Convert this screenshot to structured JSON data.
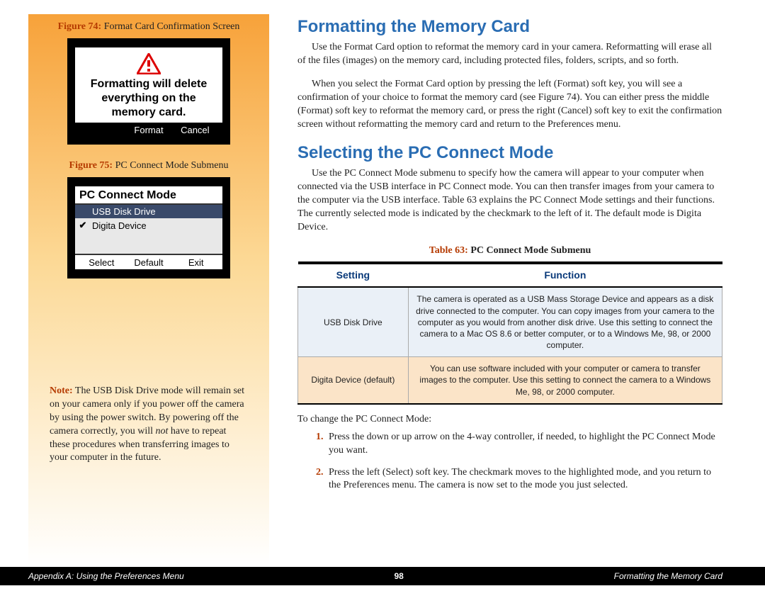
{
  "sidebar": {
    "fig74": {
      "label": "Figure 74:",
      "title": "Format Card Confirmation Screen",
      "msg": "Formatting will delete everything on the memory card.",
      "btn_left": "Format",
      "btn_right": "Cancel"
    },
    "fig75": {
      "label": "Figure 75:",
      "title": "PC Connect Mode Submenu",
      "screen_title": "PC Connect Mode",
      "opt1": "USB Disk Drive",
      "opt2": "Digita Device",
      "btn1": "Select",
      "btn2": "Default",
      "btn3": "Exit"
    },
    "note": {
      "label": "Note:",
      "text_pre": "The USB Disk Drive mode will remain set on your camera only if you power off the camera by using the power switch. By powering off the camera correctly, you will ",
      "text_em": "not",
      "text_post": " have to repeat these procedures when transferring images to your computer in the future."
    }
  },
  "content": {
    "h1a": "Formatting the Memory Card",
    "p1": "Use the Format Card option to reformat the memory card in your camera. Reformatting will erase all of the files (images) on the memory card, including protected files, folders, scripts, and so forth.",
    "p2": "When you select the Format Card option by pressing the left (Format) soft key, you will see a confirmation of your choice to format the memory card (see Figure 74). You can either press the middle (Format) soft key to reformat the memory card, or press the right (Cancel) soft key to exit the confirmation screen without reformatting the memory card and return to the Preferences menu.",
    "h1b": "Selecting the PC Connect Mode",
    "p3": "Use the PC Connect Mode submenu to specify how the camera will appear to your computer when connected via the USB interface in PC Connect mode. You can then transfer images from your camera to the computer via the USB interface. Table 63 explains the PC Connect Mode settings and their functions. The currently selected mode is indicated by the checkmark to the left of it. The default mode is Digita Device.",
    "table": {
      "label": "Table 63:",
      "title": "PC Connect Mode Submenu",
      "col1": "Setting",
      "col2": "Function",
      "rows": [
        {
          "s": "USB Disk Drive",
          "f": "The camera is operated as a USB Mass Storage Device and appears as a disk drive connected to the computer. You can copy images from your camera to the computer as you would from another disk drive. Use this setting to connect the camera to a Mac OS 8.6 or better computer, or to a Windows Me, 98, or 2000 computer."
        },
        {
          "s": "Digita Device (default)",
          "f": "You can use software included with your computer or camera to transfer images to the computer. Use this setting to connect the camera to a Windows Me, 98, or 2000 computer."
        }
      ]
    },
    "p4": "To change the PC Connect Mode:",
    "steps": [
      "Press the down or up arrow on the 4-way controller, if needed, to highlight the PC Connect Mode you want.",
      "Press the left (Select) soft key. The checkmark moves to the highlighted mode, and you return to the Preferences menu. The camera is now set to the mode you just selected."
    ]
  },
  "footer": {
    "left": "Appendix A: Using the Preferences Menu",
    "center": "98",
    "right": "Formatting the Memory Card"
  }
}
